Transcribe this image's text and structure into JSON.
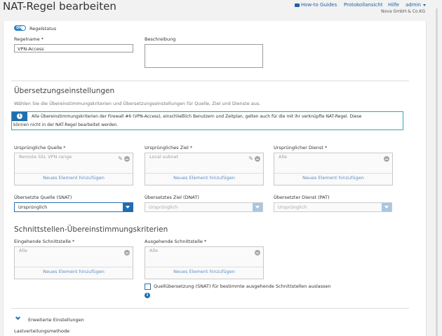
{
  "header": {
    "title": "NAT-Regel bearbeiten",
    "links": {
      "guides": "How-to Guides",
      "log": "Protokollansicht",
      "help": "Hilfe",
      "user": "admin"
    },
    "company": "Nova GmbH & Co.KG"
  },
  "rule": {
    "status_toggle": "ON",
    "status_label": "Regelstatus",
    "name_label": "Regelname *",
    "name_value": "VPN-Access",
    "description_label": "Beschreibung",
    "description_value": ""
  },
  "translation": {
    "title": "Übersetzungseinstellungen",
    "subtitle": "Wählen Sie die Übereinstimmungskriterien und Übersetzungseinstellungen für Quelle, Ziel und Dienste aus.",
    "info_line1": "Alle Übereinstimmungskriterien der Firewall #6 (VPN-Access), einschließlich Benutzern und Zeitplan, gelten auch für die mit ihr verknüpfte NAT-Regel. Diese",
    "info_line2": "können nicht in der NAT-Regel bearbeitet werden.",
    "orig_source_label": "Ursprüngliche Quelle *",
    "orig_source_value": "Remote SSL VPN range",
    "orig_dest_label": "Ursprüngliches Ziel *",
    "orig_dest_value": "Local subnet",
    "orig_service_label": "Ursprünglicher Dienst *",
    "orig_service_value": "Alle",
    "add_item": "Neues Element hinzufügen",
    "snat_label": "Übersetzte Quelle (SNAT)",
    "snat_value": "Ursprünglich",
    "dnat_label": "Übersetztes Ziel (DNAT)",
    "dnat_value": "Ursprünglich",
    "pat_label": "Übersetzter Dienst (PAT)",
    "pat_value": "Ursprünglich"
  },
  "interfaces": {
    "title": "Schnittstellen-Übereinstimmungskriterien",
    "inbound_label": "Eingehende Schnittstelle *",
    "inbound_value": "Alle",
    "outbound_label": "Ausgehende Schnittstelle *",
    "outbound_value": "Alle",
    "add_item": "Neues Element hinzufügen",
    "snat_checkbox_label": "Quellübersetzung (SNAT) für bestimmte ausgehende Schnittstellen auslassen"
  },
  "advanced": {
    "label": "Erweiterte Einstellungen",
    "load_balancing_label": "Lastverteilungsmethode"
  },
  "colors": {
    "accent": "#1f6fb0",
    "link": "#1e5fa8",
    "info_border": "#3aa0b8"
  },
  "icons": [
    "video-icon",
    "chevron-down-icon",
    "pencil-icon",
    "minus-circle-icon",
    "info-icon"
  ]
}
